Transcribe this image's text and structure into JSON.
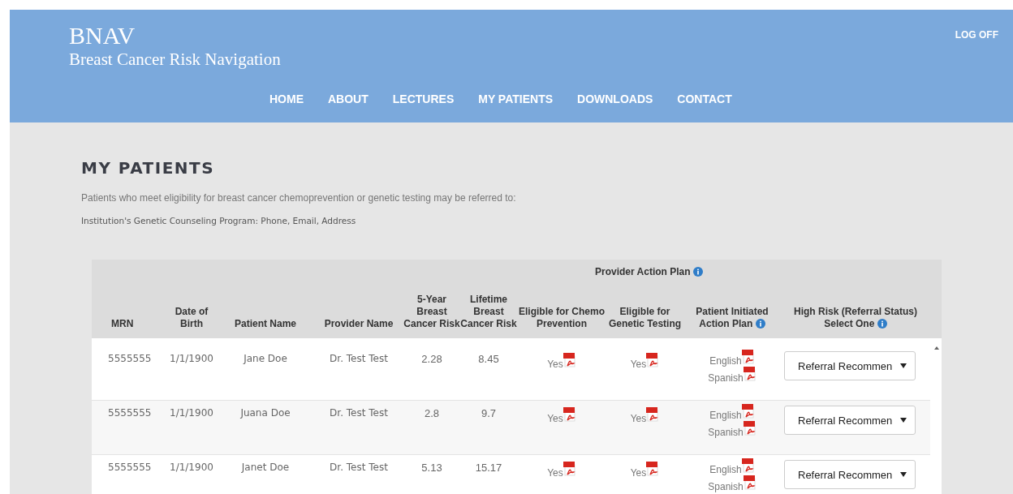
{
  "header": {
    "logo": "BNAV",
    "subtitle": "Breast Cancer Risk Navigation",
    "logoff": "LOG OFF",
    "nav": [
      "HOME",
      "ABOUT",
      "LECTURES",
      "MY PATIENTS",
      "DOWNLOADS",
      "CONTACT"
    ]
  },
  "heading": "MY PATIENTS",
  "intro": "Patients who meet eligibility for breast cancer chemoprevention or genetic testing may be referred to:",
  "contact": "Institution's Genetic Counseling Program: Phone, Email, Address",
  "table": {
    "group_header": {
      "label": "Provider Action Plan",
      "info": true
    },
    "columns": [
      {
        "label": "MRN",
        "info": false
      },
      {
        "label": "Date of Birth",
        "info": false
      },
      {
        "label": "Patient Name",
        "info": false
      },
      {
        "label": "Provider Name",
        "info": false
      },
      {
        "label": "5-Year Breast Cancer Risk",
        "info": false
      },
      {
        "label": "Lifetime Breast Cancer Risk",
        "info": false
      },
      {
        "label": "Eligible for Chemo Prevention",
        "info": false
      },
      {
        "label": "Eligible for Genetic Testing",
        "info": false
      },
      {
        "label": "Patient Initiated Action Plan",
        "info": true
      },
      {
        "label": "High Risk (Referral Status) Select One",
        "info": true
      }
    ],
    "rows": [
      {
        "mrn": "5555555",
        "dob": "1/1/1900",
        "patient": "Jane Doe",
        "provider": "Dr. Test Test",
        "five_year": "2.28",
        "lifetime": "8.45",
        "chemo": "Yes",
        "genetic": "Yes",
        "plans": [
          "English",
          "Spanish"
        ],
        "referral": "Referral Recommen"
      },
      {
        "mrn": "5555555",
        "dob": "1/1/1900",
        "patient": "Juana Doe",
        "provider": "Dr. Test Test",
        "five_year": "2.8",
        "lifetime": "9.7",
        "chemo": "Yes",
        "genetic": "Yes",
        "plans": [
          "English",
          "Spanish"
        ],
        "referral": "Referral Recommen"
      },
      {
        "mrn": "5555555",
        "dob": "1/1/1900",
        "patient": "Janet Doe",
        "provider": "Dr. Test Test",
        "five_year": "5.13",
        "lifetime": "15.17",
        "chemo": "Yes",
        "genetic": "Yes",
        "plans": [
          "English",
          "Spanish"
        ],
        "referral": "Referral Recommen"
      }
    ]
  }
}
